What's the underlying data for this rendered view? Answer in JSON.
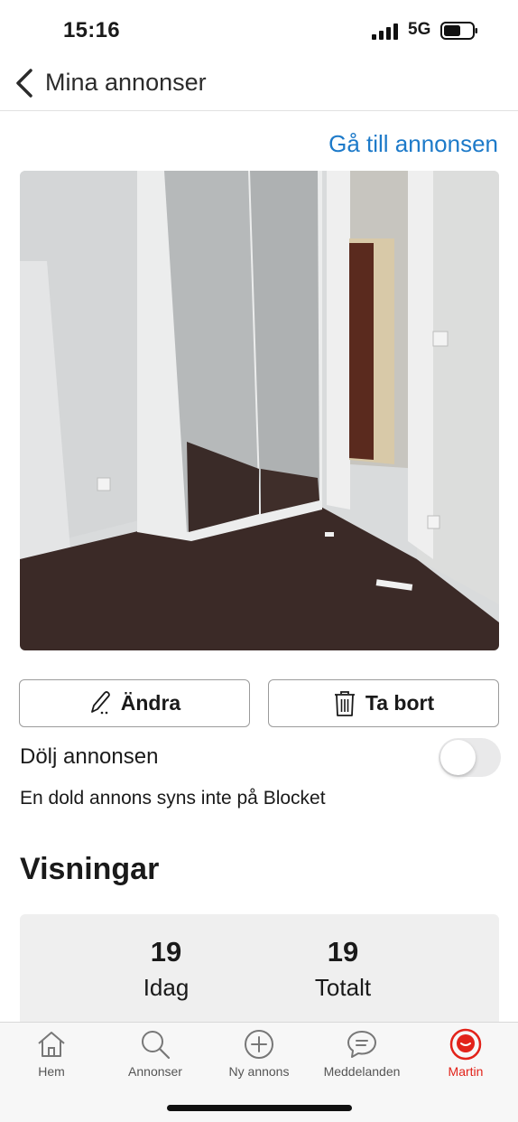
{
  "status_bar": {
    "time": "15:16",
    "network": "5G"
  },
  "nav": {
    "title": "Mina annonser"
  },
  "listing": {
    "goto_link": "Gå till annonsen",
    "photo_name": "ad-photo"
  },
  "actions": {
    "edit_label": "Ändra",
    "delete_label": "Ta bort"
  },
  "hide_setting": {
    "label": "Dölj annonsen",
    "description": "En dold annons syns inte på Blocket",
    "enabled": false
  },
  "views": {
    "title": "Visningar",
    "today_value": "19",
    "today_label": "Idag",
    "total_value": "19",
    "total_label": "Totalt"
  },
  "tab_bar": {
    "items": [
      {
        "label": "Hem",
        "icon": "home-icon"
      },
      {
        "label": "Annonser",
        "icon": "search-icon"
      },
      {
        "label": "Ny annons",
        "icon": "plus-circle-icon"
      },
      {
        "label": "Meddelanden",
        "icon": "chat-icon"
      },
      {
        "label": "Martin",
        "icon": "profile-icon",
        "active": true
      }
    ]
  },
  "colors": {
    "accent_link": "#1d7ac9",
    "brand_red": "#e2231a",
    "toggle_off": "#e9e9ea"
  }
}
